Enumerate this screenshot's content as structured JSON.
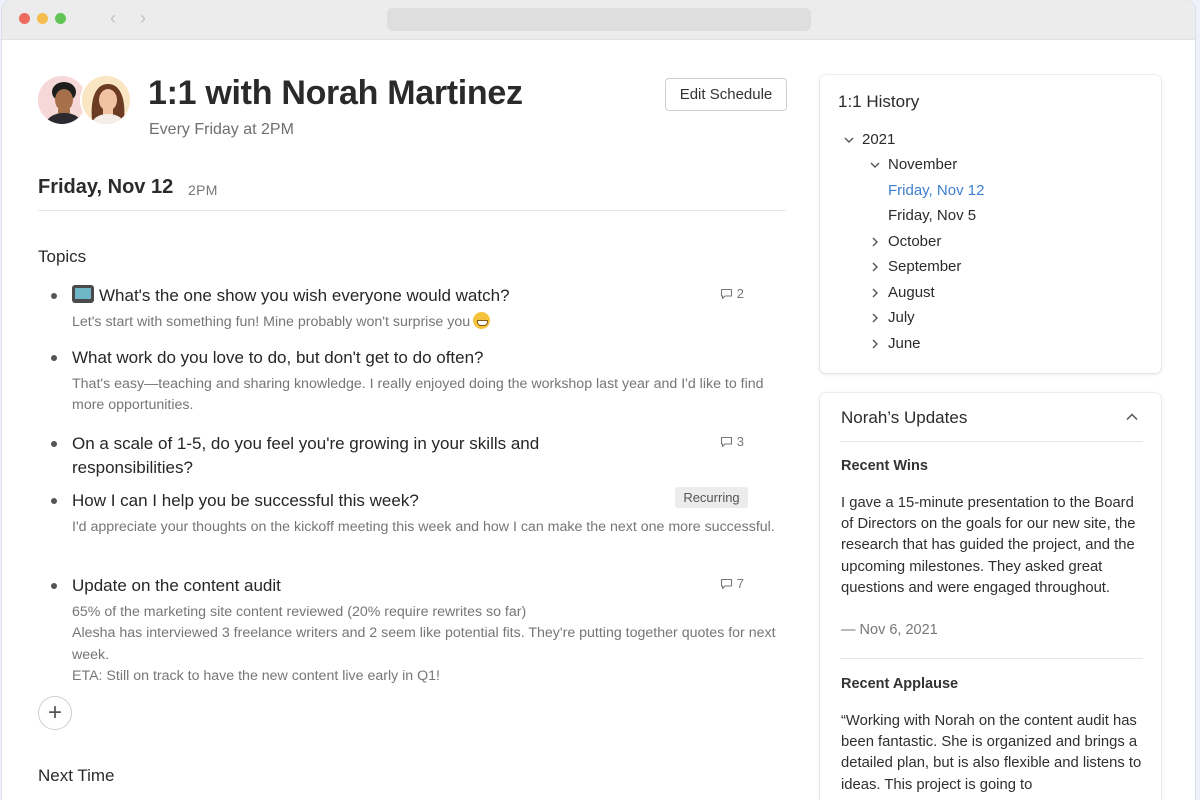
{
  "meeting": {
    "title": "1:1 with Norah Martinez",
    "schedule": "Every Friday at 2PM",
    "edit_label": "Edit Schedule",
    "date": "Friday, Nov 12",
    "time": "2PM"
  },
  "topics": {
    "heading": "Topics",
    "items": [
      {
        "question": "What's the one show you wish everyone would watch?",
        "note": "Let's start with something fun! Mine probably won't surprise you",
        "comments": "2",
        "icon": "tv-icon"
      },
      {
        "question": "What work do you love to do, but don't get to do often?",
        "note": "That's easy—teaching and sharing knowledge. I really enjoyed doing the workshop last year and I'd like to find more opportunities."
      },
      {
        "question": "On a scale of 1-5, do you feel you're growing in your skills and responsibilities?",
        "comments": "3"
      },
      {
        "question": "How I can I help you be successful this week?",
        "badge": "Recurring",
        "note": "I'd appreciate your thoughts on the kickoff meeting this week and how I can make the next one more successful."
      },
      {
        "question": "Update on the content audit",
        "comments": "7",
        "notes": [
          "65% of the marketing site content reviewed (20% require rewrites so far)",
          "Alesha has interviewed 3 freelance writers and 2 seem like potential fits. They're putting together quotes for next week.",
          "ETA: Still on track to have the new content live early in Q1!"
        ]
      }
    ]
  },
  "add_topic_label": "+",
  "next_time": {
    "heading": "Next Time"
  },
  "history": {
    "title": "1:1 History",
    "year": "2021",
    "expanded_month": "November",
    "entries": [
      "Friday, Nov 12",
      "Friday, Nov 5"
    ],
    "collapsed_months": [
      "October",
      "September",
      "August",
      "July",
      "June"
    ]
  },
  "updates": {
    "title": "Norah’s Updates",
    "wins_heading": "Recent Wins",
    "wins_text": "I gave a 15-minute presentation to the Board of Directors on the goals for our new site, the research that has guided the project, and the upcoming milestones. They asked great questions and were engaged throughout.",
    "wins_date": "— Nov 6, 2021",
    "applause_heading": "Recent Applause",
    "applause_text": "“Working with Norah on the content audit has been fantastic. She is organized and brings a detailed plan, but is also flexible and listens to ideas. This project is going to"
  },
  "colors": {
    "accent": "#3f7fcf",
    "text": "#2b2b2b",
    "muted": "#767676"
  }
}
